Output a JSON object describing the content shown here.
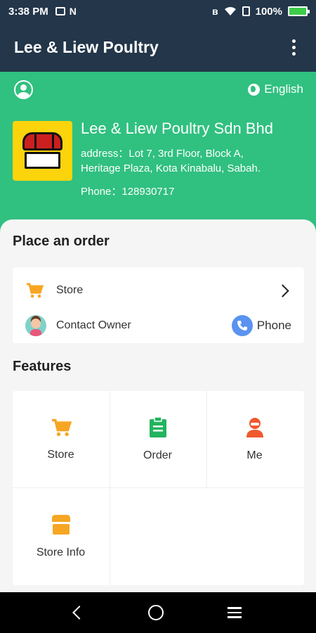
{
  "status_bar": {
    "time": "3:38 PM",
    "battery": "100%"
  },
  "app_bar": {
    "title": "Lee & Liew Poultry"
  },
  "hero": {
    "language": "English",
    "store_name": "Lee & Liew Poultry Sdn Bhd",
    "address_line1": "address：Lot 7, 3rd Floor, Block A,",
    "address_line2": "Heritage Plaza, Kota Kinabalu, Sabah.",
    "phone": "Phone：128930717"
  },
  "order_section": {
    "title": "Place an order",
    "store_label": "Store",
    "contact_label": "Contact Owner",
    "phone_label": "Phone"
  },
  "features": {
    "title": "Features",
    "items": [
      {
        "label": "Store",
        "icon": "cart-icon"
      },
      {
        "label": "Order",
        "icon": "clipboard-icon"
      },
      {
        "label": "Me",
        "icon": "person-icon"
      },
      {
        "label": "Store Info",
        "icon": "shop-icon"
      }
    ]
  },
  "colors": {
    "header": "#23364a",
    "accent_green": "#30c080",
    "cart_orange": "#f6a623",
    "order_green": "#22b35e",
    "me_red": "#f0592f",
    "phone_blue": "#5a93f0"
  }
}
